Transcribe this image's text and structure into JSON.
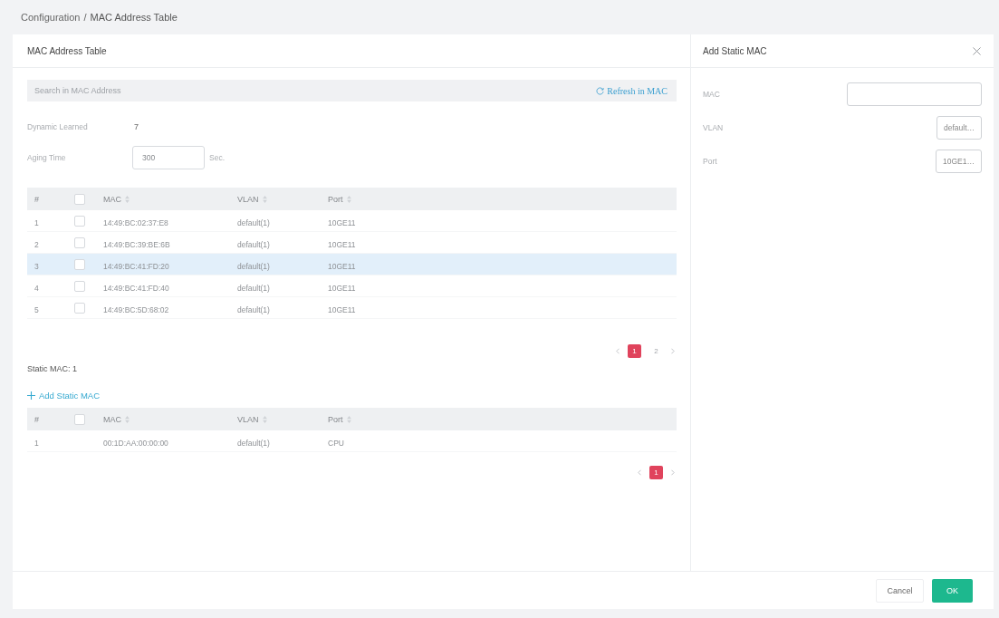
{
  "breadcrumb": {
    "items": [
      "Configuration",
      "MAC Address Table"
    ],
    "separator": "/"
  },
  "main_panel": {
    "title": "MAC Address Table",
    "search": {
      "placeholder": "Search in MAC Address",
      "refresh_link": "Refresh in MAC"
    },
    "stats": [
      {
        "label": "Dynamic Learned",
        "kind": "text",
        "value": "7"
      },
      {
        "label": "Aging Time",
        "kind": "input",
        "value": "300",
        "unit": "Sec."
      }
    ],
    "tables": [
      {
        "select_all_checked": false,
        "columns": [
          {
            "label": "#",
            "sortable": false
          },
          {
            "label": "MAC",
            "sortable": true
          },
          {
            "label": "VLAN",
            "sortable": true
          },
          {
            "label": "Port",
            "sortable": true
          }
        ],
        "rows": [
          {
            "cells": [
              "1",
              "14:49:BC:02:37:E8",
              "default(1)",
              "10GE11"
            ],
            "checked": false,
            "hovered": false
          },
          {
            "cells": [
              "2",
              "14:49:BC:39:BE:6B",
              "default(1)",
              "10GE11"
            ],
            "checked": false,
            "hovered": false
          },
          {
            "cells": [
              "3",
              "14:49:BC:41:FD:20",
              "default(1)",
              "10GE11"
            ],
            "checked": false,
            "hovered": true
          },
          {
            "cells": [
              "4",
              "14:49:BC:41:FD:40",
              "default(1)",
              "10GE11"
            ],
            "checked": false,
            "hovered": false
          },
          {
            "cells": [
              "5",
              "14:49:BC:5D:68:02",
              "default(1)",
              "10GE11"
            ],
            "checked": false,
            "hovered": false
          }
        ],
        "pagination": {
          "pages": [
            {
              "label": "1",
              "selected": true
            },
            {
              "label": "2",
              "selected": false
            }
          ]
        }
      },
      {
        "count": "Static MAC: 1",
        "add_link": "Add Static MAC",
        "select_all_checked": false,
        "columns": [
          {
            "label": "#",
            "sortable": false
          },
          {
            "label": "MAC",
            "sortable": true
          },
          {
            "label": "VLAN",
            "sortable": true
          },
          {
            "label": "Port",
            "sortable": true
          }
        ],
        "rows": [
          {
            "cells": [
              "1",
              "00:1D:AA:00:00:00",
              "default(1)",
              "CPU"
            ],
            "hovered": false
          }
        ],
        "pagination": {
          "pages": [
            {
              "label": "1",
              "selected": true
            }
          ]
        }
      }
    ]
  },
  "side_panel": {
    "title": "Add Static MAC",
    "fields": [
      {
        "label": "MAC",
        "kind": "input"
      },
      {
        "label": "VLAN",
        "kind": "select",
        "value": "default…"
      },
      {
        "label": "Port",
        "kind": "select",
        "value": "10GE1…"
      }
    ]
  },
  "footer": {
    "buttons": [
      {
        "label": "Cancel",
        "kind": "default"
      },
      {
        "label": "OK",
        "kind": "primary"
      }
    ]
  }
}
